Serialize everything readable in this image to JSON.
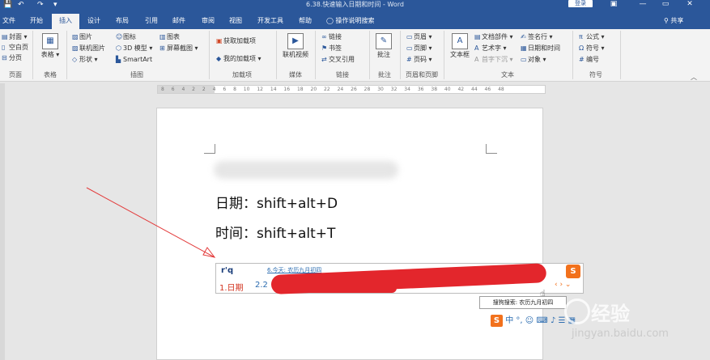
{
  "window": {
    "title": "6.38.快速输入日期和时间 - Word",
    "login_label": "登录",
    "minimize_glyph": "—",
    "restore_glyph": "▭",
    "close_glyph": "✕",
    "save_icon": "💾",
    "undo_icon": "↶",
    "redo_icon": "↷",
    "customize_icon": "▾"
  },
  "tabs": [
    {
      "label": "文件"
    },
    {
      "label": "开始"
    },
    {
      "label": "插入"
    },
    {
      "label": "设计"
    },
    {
      "label": "布局"
    },
    {
      "label": "引用"
    },
    {
      "label": "邮件"
    },
    {
      "label": "审阅"
    },
    {
      "label": "视图"
    },
    {
      "label": "开发工具"
    },
    {
      "label": "帮助"
    }
  ],
  "tell_me": "操作说明搜索",
  "tell_me_icon": "◯",
  "share_label": "共享",
  "ribbon": {
    "pages": {
      "items": [
        "封面",
        "空白页",
        "分页"
      ],
      "label": "页面"
    },
    "tables": {
      "button": "表格",
      "label": "表格"
    },
    "illustrations": {
      "items": [
        "图片",
        "联机图片",
        "形状",
        "图标",
        "3D 模型",
        "SmartArt",
        "图表",
        "屏幕截图"
      ],
      "label": "插图"
    },
    "addins": {
      "items": [
        "获取加载项",
        "我的加载项"
      ],
      "label": "加载项"
    },
    "media": {
      "button": "联机视频",
      "label": "媒体"
    },
    "links": {
      "items": [
        "链接",
        "书签",
        "交叉引用"
      ],
      "label": "链接"
    },
    "comments": {
      "button": "批注",
      "label": "批注"
    },
    "header_footer": {
      "items": [
        "页眉",
        "页脚",
        "页码"
      ],
      "label": "页眉和页脚"
    },
    "text": {
      "textbox": "文本框",
      "items": [
        "文档部件",
        "艺术字",
        "首字下沉",
        "签名行",
        "日期和时间",
        "对象"
      ],
      "label": "文本"
    },
    "symbols": {
      "items": [
        "公式",
        "符号",
        "编号"
      ],
      "label": "符号"
    }
  },
  "ruler": {
    "marks": "8 6 4 2 2 4 6 8 10 12 14 16 18 20 22 24 26 28 30 32 34 36 38 40 42 44 46 48"
  },
  "document": {
    "line_date": "日期：shift+alt+D",
    "line_time": "时间：shift+alt+T"
  },
  "ime": {
    "pinyin": "r'q",
    "suggestion": "6.今天: 农历九月初四",
    "candidate_1": "1.日期",
    "candidate_2_prefix": "2.2",
    "logo": "S",
    "arrows": "‹ › ⌄",
    "tooltip": "搜狗搜索: 农历九月初四",
    "toolbar_logo": "S",
    "toolbar_text": "中 °, ☺ ⌨ ♪ ☰ ▦"
  },
  "watermark": {
    "main": "经验",
    "sub": "jingyan.baidu.com"
  }
}
